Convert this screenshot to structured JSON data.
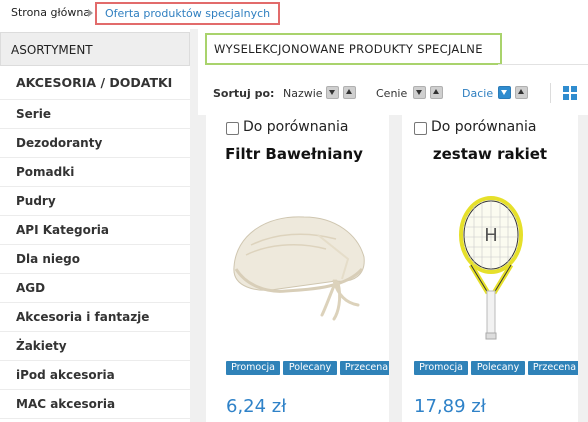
{
  "breadcrumb": {
    "home": "Strona główna",
    "current": "Oferta produktów specjalnych"
  },
  "sidebar": {
    "title": "ASORTYMENT",
    "items": [
      {
        "label": "AKCESORIA / DODATKI"
      },
      {
        "label": "Serie"
      },
      {
        "label": "Dezodoranty"
      },
      {
        "label": "Pomadki"
      },
      {
        "label": "Pudry"
      },
      {
        "label": "API Kategoria"
      },
      {
        "label": "Dla niego"
      },
      {
        "label": "AGD"
      },
      {
        "label": "Akcesoria i fantazje"
      },
      {
        "label": "Żakiety"
      },
      {
        "label": "iPod akcesoria"
      },
      {
        "label": "MAC akcesoria"
      }
    ]
  },
  "main": {
    "section_title": "WYSELEKCJONOWANE PRODUKTY SPECJALNE",
    "sort": {
      "label": "Sortuj po:",
      "options": [
        {
          "label": "Nazwie",
          "active": false
        },
        {
          "label": "Cenie",
          "active": false
        },
        {
          "label": "Dacie",
          "active": true
        }
      ]
    },
    "view_icon": "grid-view-icon",
    "accent_color": "#2f82c8",
    "products": [
      {
        "compare_label": "Do porównania",
        "name": "Filtr Bawełniany",
        "image": "cotton-filter-image",
        "badges": [
          "Promocja",
          "Polecany",
          "Przecena"
        ],
        "price": "6,24 zł"
      },
      {
        "compare_label": "Do porównania",
        "name": "zestaw rakiet",
        "image": "tennis-racket-image",
        "badges": [
          "Promocja",
          "Polecany",
          "Przecena"
        ],
        "price": "17,89 zł"
      }
    ]
  }
}
